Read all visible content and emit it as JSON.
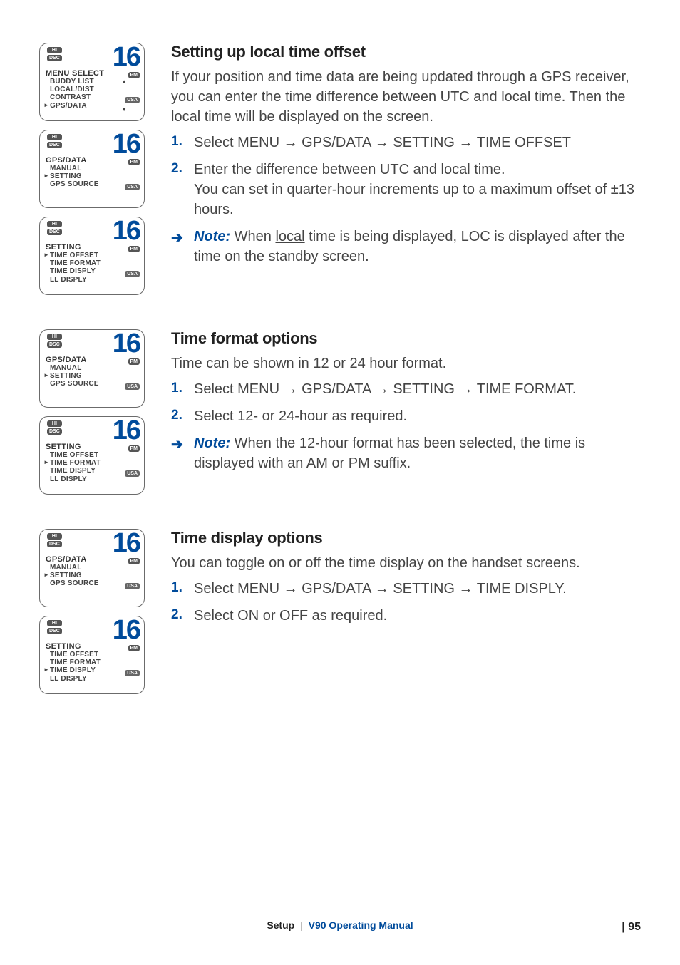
{
  "sections": [
    {
      "heading": "Setting up local time offset",
      "intro": "If your position and time data are being updated through a GPS receiver, you can enter the time difference between UTC and local time. Then the local time will be displayed on the screen.",
      "steps": [
        "Select MENU → GPS/DATA → SETTING → TIME OFFSET",
        "Enter the difference between UTC and local time.\nYou can set in quarter-hour increments up to a maximum offset of ±13 hours."
      ],
      "note": {
        "prefix": "Note:",
        "before": "When ",
        "underlined": "local",
        "after": " time is being displayed, LOC is displayed after the time on the standby screen."
      },
      "screens": [
        {
          "title": "MENU SELECT",
          "rows": [
            "BUDDY LIST",
            "LOCAL/DIST",
            "CONTRAST",
            "GPS/DATA"
          ],
          "sel": 3,
          "arrows": true
        },
        {
          "title": "GPS/DATA",
          "rows": [
            "MANUAL",
            "SETTING",
            "GPS SOURCE"
          ],
          "sel": 1,
          "arrows": false
        },
        {
          "title": "SETTING",
          "rows": [
            "TIME OFFSET",
            "TIME FORMAT",
            "TIME DISPLY",
            "LL DISPLY"
          ],
          "sel": 0,
          "arrows": false
        }
      ]
    },
    {
      "heading": "Time format options",
      "intro": "Time can be shown in 12 or 24 hour format.",
      "steps": [
        "Select MENU → GPS/DATA → SETTING → TIME FORMAT.",
        "Select 12- or 24-hour as required."
      ],
      "note": {
        "prefix": "Note:",
        "before": "When the 12-hour format has been selected, the time is displayed with an AM or PM suffix.",
        "underlined": "",
        "after": ""
      },
      "screens": [
        {
          "title": "GPS/DATA",
          "rows": [
            "MANUAL",
            "SETTING",
            "GPS SOURCE"
          ],
          "sel": 1,
          "arrows": false
        },
        {
          "title": "SETTING",
          "rows": [
            "TIME OFFSET",
            "TIME FORMAT",
            "TIME DISPLY",
            "LL DISPLY"
          ],
          "sel": 1,
          "arrows": false
        }
      ]
    },
    {
      "heading": "Time display options",
      "intro": "You can toggle on or off the time display on the handset screens.",
      "steps": [
        "Select MENU → GPS/DATA → SETTING → TIME DISPLY.",
        "Select ON or OFF as required."
      ],
      "note": null,
      "screens": [
        {
          "title": "GPS/DATA",
          "rows": [
            "MANUAL",
            "SETTING",
            "GPS SOURCE"
          ],
          "sel": 1,
          "arrows": false
        },
        {
          "title": "SETTING",
          "rows": [
            "TIME OFFSET",
            "TIME FORMAT",
            "TIME DISPLY",
            "LL DISPLY"
          ],
          "sel": 2,
          "arrows": false
        }
      ]
    }
  ],
  "channel": "16",
  "badges": {
    "hi": "HI",
    "dsc": "DSC",
    "pm": "PM",
    "usa": "USA"
  },
  "footer": {
    "setup": "Setup",
    "manual": "V90 Operating Manual"
  },
  "page": "95"
}
